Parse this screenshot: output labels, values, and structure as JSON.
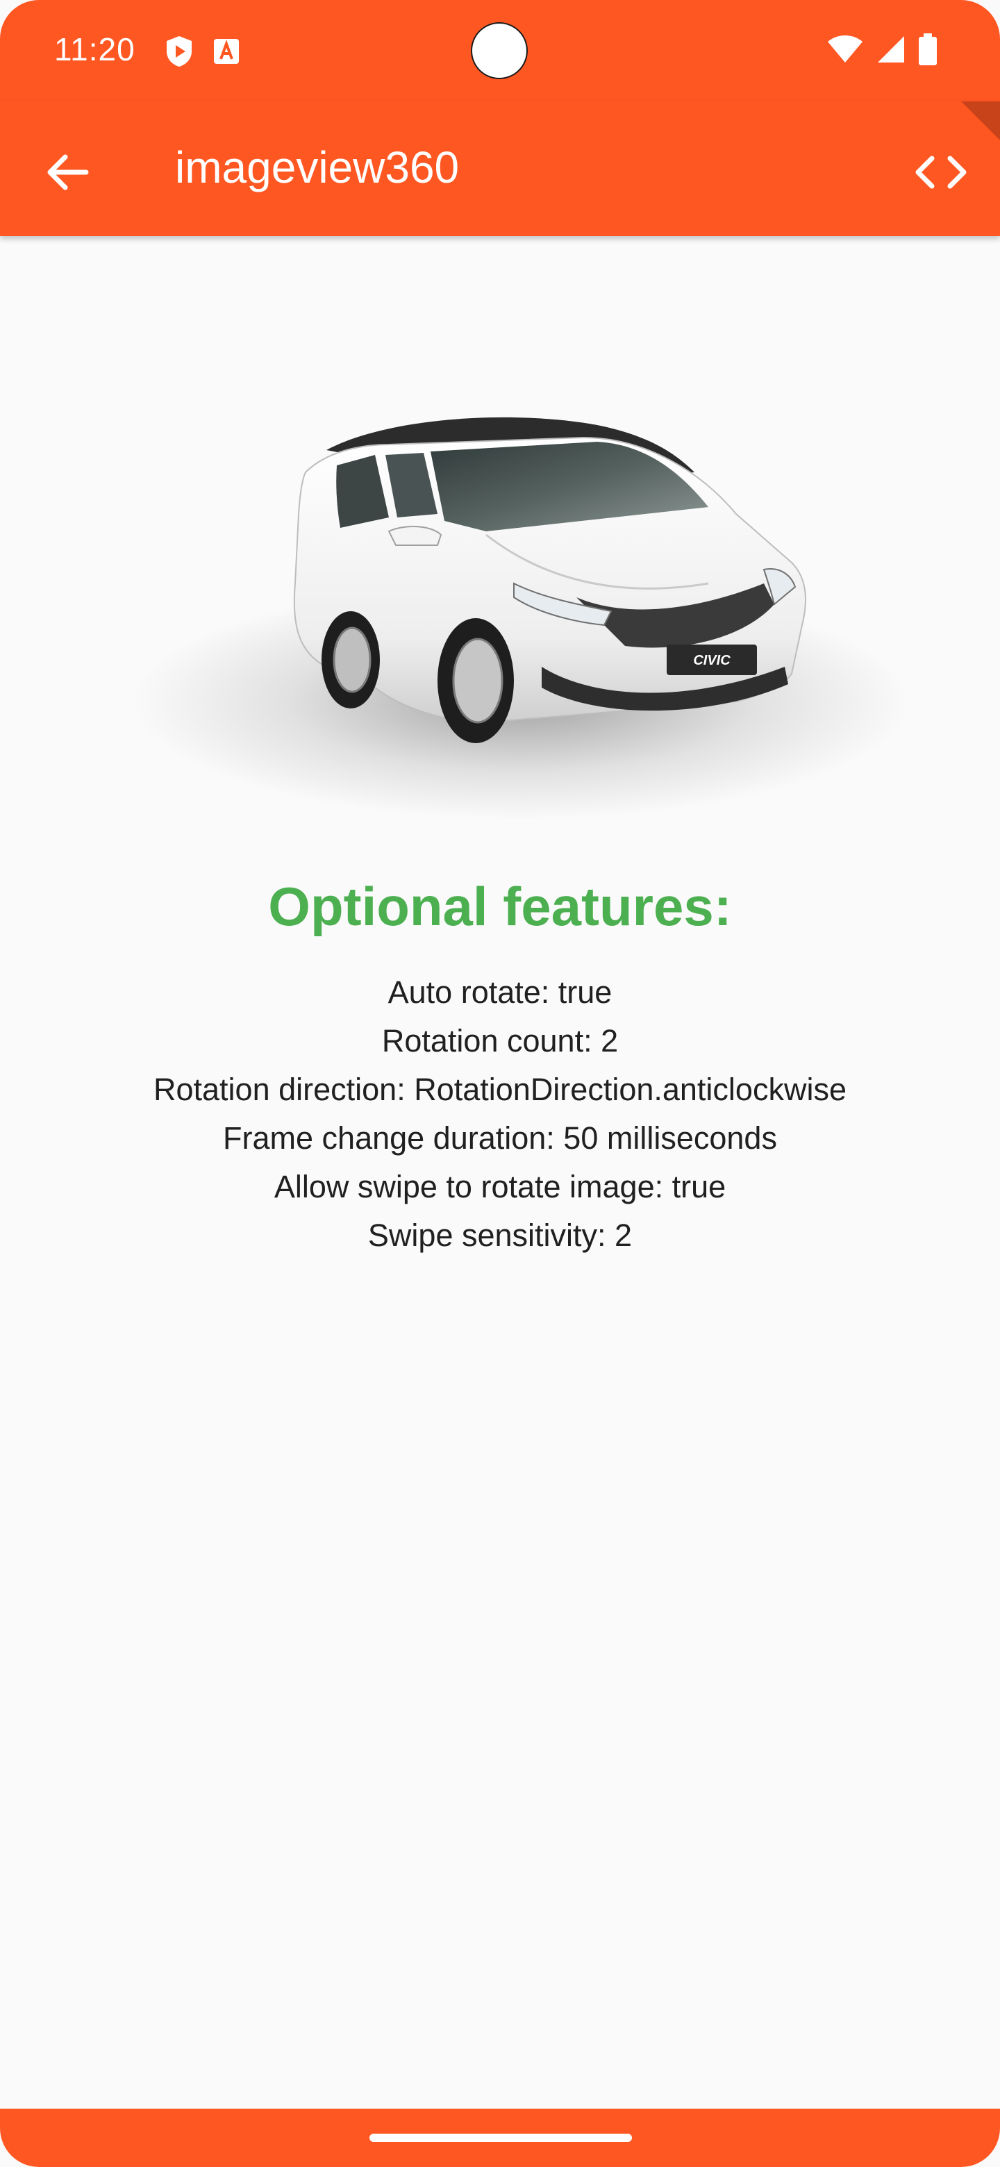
{
  "status_bar": {
    "time": "11:20",
    "left_icons": [
      "shield-play-icon",
      "font-a-icon"
    ],
    "right_icons": [
      "wifi-icon",
      "signal-icon",
      "battery-icon"
    ]
  },
  "app_bar": {
    "title": "imageview360",
    "back_icon": "arrow-back-icon",
    "code_icon": "code-brackets-icon"
  },
  "colors": {
    "accent": "#ff5722",
    "title_green": "#4caf50",
    "background": "#fafafa"
  },
  "image": {
    "badge_text": "CIVIC"
  },
  "features": {
    "title": "Optional features:",
    "lines": [
      "Auto rotate: true",
      "Rotation count: 2",
      "Rotation direction: RotationDirection.anticlockwise",
      "Frame change duration: 50 milliseconds",
      "Allow swipe to rotate image: true",
      "Swipe sensitivity: 2"
    ]
  }
}
